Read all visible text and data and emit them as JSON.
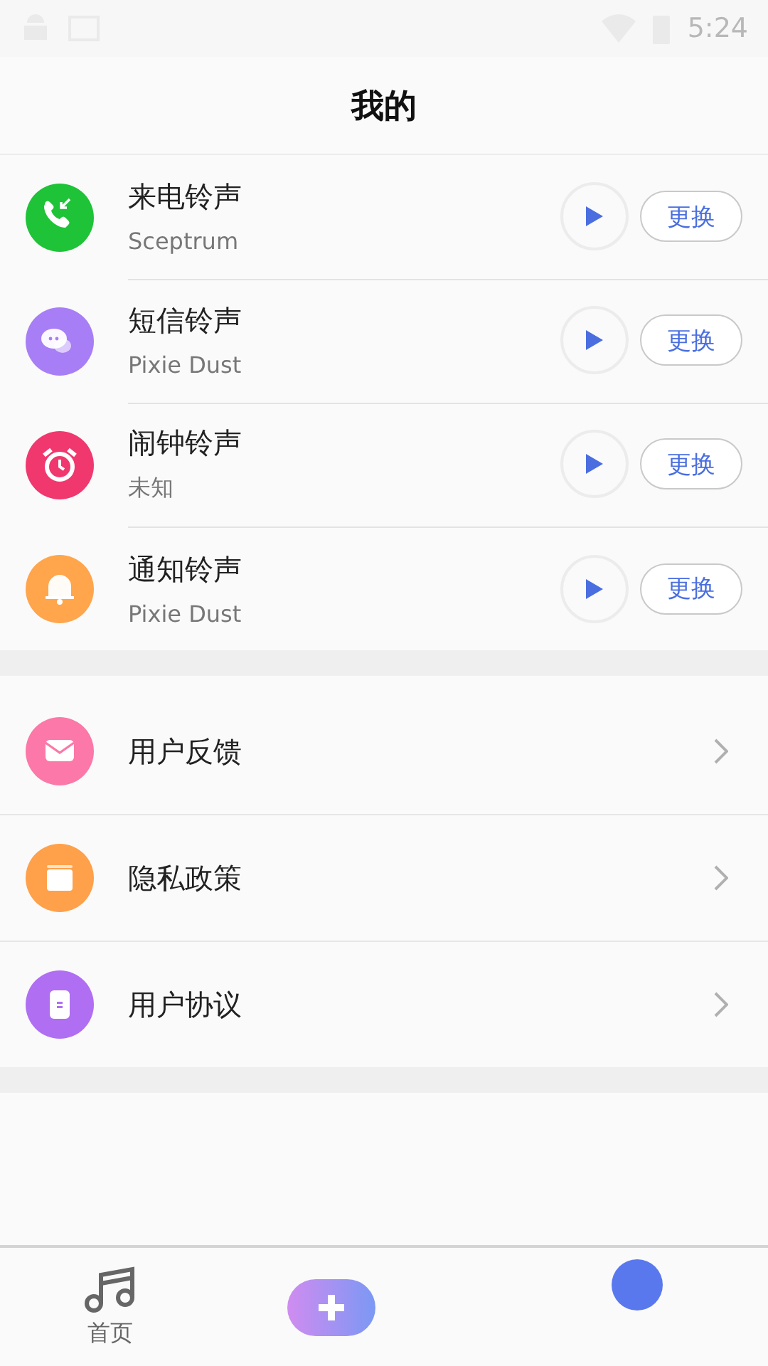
{
  "status_bar": {
    "time": "5:24"
  },
  "header": {
    "title": "我的"
  },
  "ringtones": [
    {
      "kind": "call",
      "title": "来电铃声",
      "subtitle": "Sceptrum",
      "button": "更换",
      "color": "#1ec337"
    },
    {
      "kind": "message",
      "title": "短信铃声",
      "subtitle": "Pixie Dust",
      "button": "更换",
      "color": "#a77ef5"
    },
    {
      "kind": "alarm",
      "title": "闹钟铃声",
      "subtitle": "未知",
      "button": "更换",
      "color": "#f0386e"
    },
    {
      "kind": "notification",
      "title": "通知铃声",
      "subtitle": "Pixie Dust",
      "button": "更换",
      "color": "#ffa54c"
    }
  ],
  "menu": [
    {
      "kind": "feedback",
      "label": "用户反馈",
      "color": "#fb78a8"
    },
    {
      "kind": "privacy",
      "label": "隐私政策",
      "color": "#ffa04a"
    },
    {
      "kind": "agreement",
      "label": "用户协议",
      "color": "#b06ef2"
    }
  ],
  "bottom_nav": [
    {
      "kind": "music",
      "label": "首页"
    },
    {
      "kind": "add"
    },
    {
      "kind": "profile"
    }
  ]
}
